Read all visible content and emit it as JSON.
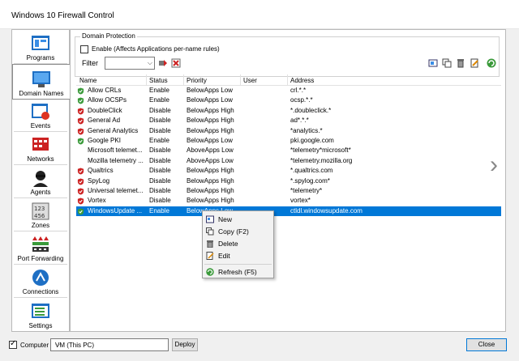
{
  "window": {
    "title": "Windows 10 Firewall Control"
  },
  "sidebar": {
    "items": [
      {
        "label": "Programs",
        "icon": "programs-icon"
      },
      {
        "label": "Domain Names",
        "icon": "domain-names-icon",
        "selected": true
      },
      {
        "label": "Events",
        "icon": "events-icon"
      },
      {
        "label": "Networks",
        "icon": "networks-icon"
      },
      {
        "label": "Agents",
        "icon": "agents-icon"
      },
      {
        "label": "Zones",
        "icon": "zones-icon"
      },
      {
        "label": "Port Forwarding",
        "icon": "port-forwarding-icon"
      },
      {
        "label": "Connections",
        "icon": "connections-icon"
      },
      {
        "label": "Settings",
        "icon": "settings-icon"
      }
    ]
  },
  "main": {
    "group_title": "Domain Protection",
    "enable_label": "Enable  (Affects Applications per-name rules)",
    "filter_label": "Filter",
    "filter_value": ""
  },
  "table": {
    "columns": [
      "Name",
      "Status",
      "Priority",
      "User",
      "Address"
    ],
    "rows": [
      {
        "name": "Allow CRLs",
        "status": "Enable",
        "priority": "BelowApps Low",
        "user": "",
        "address": "crl.*.*",
        "shield": "green"
      },
      {
        "name": "Allow OCSPs",
        "status": "Enable",
        "priority": "BelowApps Low",
        "user": "",
        "address": "ocsp.*.*",
        "shield": "green"
      },
      {
        "name": "DoubleClick",
        "status": "Disable",
        "priority": "BelowApps High",
        "user": "",
        "address": "*.doubleclick.*",
        "shield": "red"
      },
      {
        "name": "General Ad",
        "status": "Disable",
        "priority": "BelowApps High",
        "user": "",
        "address": "ad*.*.*",
        "shield": "red"
      },
      {
        "name": "General Analytics",
        "status": "Disable",
        "priority": "BelowApps High",
        "user": "",
        "address": "*analytics.*",
        "shield": "red"
      },
      {
        "name": "Google PKI",
        "status": "Enable",
        "priority": "BelowApps Low",
        "user": "",
        "address": "pki.google.com",
        "shield": "green"
      },
      {
        "name": "Microsoft telemet...",
        "status": "Disable",
        "priority": "AboveApps Low",
        "user": "",
        "address": "*telemetry*microsoft*",
        "shield": "none"
      },
      {
        "name": "Mozilla telemetry ...",
        "status": "Disable",
        "priority": "AboveApps Low",
        "user": "",
        "address": "*telemetry.mozilla.org",
        "shield": "none"
      },
      {
        "name": "Qualtrics",
        "status": "Disable",
        "priority": "BelowApps High",
        "user": "",
        "address": "*.qualtrics.com",
        "shield": "red"
      },
      {
        "name": "SpyLog",
        "status": "Disable",
        "priority": "BelowApps High",
        "user": "",
        "address": "*.spylog.com*",
        "shield": "red"
      },
      {
        "name": "Universal telemet...",
        "status": "Disable",
        "priority": "BelowApps High",
        "user": "",
        "address": "*telemetry*",
        "shield": "red"
      },
      {
        "name": "Vortex",
        "status": "Disable",
        "priority": "BelowApps High",
        "user": "",
        "address": "vortex*",
        "shield": "red"
      },
      {
        "name": "WindowsUpdate ...",
        "status": "Enable",
        "priority": "BelowApps Low",
        "user": "",
        "address": "ctldl.windowsupdate.com",
        "shield": "green",
        "selected": true
      }
    ]
  },
  "context_menu": {
    "items": [
      {
        "label": "New",
        "icon": "new-icon"
      },
      {
        "label": "Copy (F2)",
        "icon": "copy-icon"
      },
      {
        "label": "Delete",
        "icon": "trash-icon"
      },
      {
        "label": "Edit",
        "icon": "edit-icon"
      },
      {
        "label": "Refresh (F5)",
        "icon": "refresh-icon"
      }
    ]
  },
  "bottom": {
    "computer_label": "Computer",
    "computer_value": "VM (This PC)",
    "deploy_label": "Deploy",
    "close_label": "Close"
  },
  "colors": {
    "selection": "#0078d7",
    "shield_green": "#3a9a3a",
    "shield_red": "#cc2222"
  }
}
